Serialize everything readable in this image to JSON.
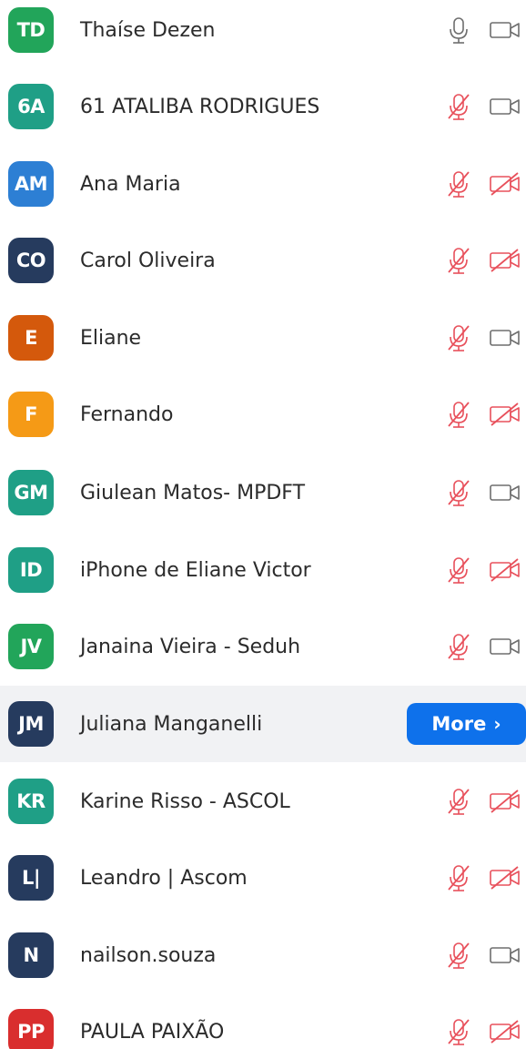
{
  "colors": {
    "accent": "#0e71eb",
    "muted_icon": "#e8505b",
    "normal_icon": "#6e6e6e",
    "hover_row": "#f1f2f4"
  },
  "participants": [
    {
      "initials": "TD",
      "name": "Thaíse Dezen",
      "avatar_color": "#22a55a",
      "mic": "on",
      "video": "on"
    },
    {
      "initials": "6A",
      "name": "61 ATALIBA RODRIGUES",
      "avatar_color": "#1f9f86",
      "mic": "muted",
      "video": "on"
    },
    {
      "initials": "AM",
      "name": "Ana Maria",
      "avatar_color": "#2d7fd4",
      "mic": "muted",
      "video": "off"
    },
    {
      "initials": "CO",
      "name": "Carol Oliveira",
      "avatar_color": "#263b5e",
      "mic": "muted",
      "video": "off"
    },
    {
      "initials": "E",
      "name": "Eliane",
      "avatar_color": "#d4590c",
      "mic": "muted",
      "video": "on"
    },
    {
      "initials": "F",
      "name": "Fernando",
      "avatar_color": "#f59a16",
      "mic": "muted",
      "video": "off"
    },
    {
      "initials": "GM",
      "name": "Giulean Matos- MPDFT",
      "avatar_color": "#1f9f86",
      "mic": "muted",
      "video": "on"
    },
    {
      "initials": "ID",
      "name": "iPhone de Eliane Victor",
      "avatar_color": "#1f9f86",
      "mic": "muted",
      "video": "off"
    },
    {
      "initials": "JV",
      "name": "Janaina Vieira - Seduh",
      "avatar_color": "#22a55a",
      "mic": "muted",
      "video": "on"
    },
    {
      "initials": "JM",
      "name": "Juliana Manganelli",
      "avatar_color": "#263b5e",
      "mic": "",
      "video": "",
      "more_label": "More",
      "more_chevron": "›"
    },
    {
      "initials": "KR",
      "name": "Karine Risso - ASCOL",
      "avatar_color": "#1f9f86",
      "mic": "muted",
      "video": "off"
    },
    {
      "initials": "L|",
      "name": "Leandro | Ascom",
      "avatar_color": "#263b5e",
      "mic": "muted",
      "video": "off"
    },
    {
      "initials": "N",
      "name": "nailson.souza",
      "avatar_color": "#263b5e",
      "mic": "muted",
      "video": "on"
    },
    {
      "initials": "PP",
      "name": "PAULA PAIXÃO",
      "avatar_color": "#d92e2e",
      "mic": "muted",
      "video": "off"
    }
  ]
}
